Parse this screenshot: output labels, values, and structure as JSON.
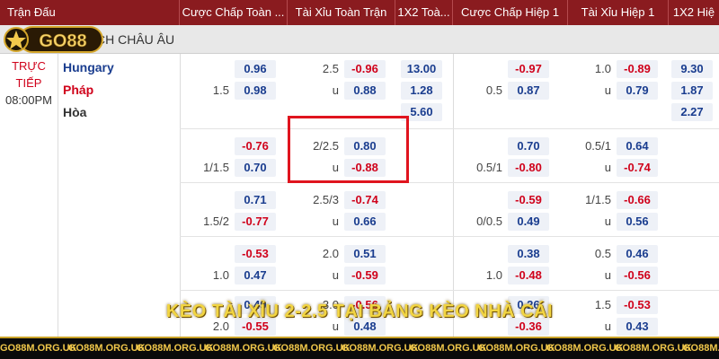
{
  "header": {
    "col_match": "Trận Đấu",
    "col_hcp_ft": "Cược Chấp Toàn ...",
    "col_ou_ft": "Tài Xỉu Toàn Trận",
    "col_1x2_ft": "1X2 Toà...",
    "col_hcp_h1": "Cược Chấp Hiệp 1",
    "col_ou_h1": "Tài Xỉu Hiệp 1",
    "col_1x2_h1": "1X2 Hiệ"
  },
  "league": "CH CHÂU ÂU",
  "logo_text": "GO88",
  "match": {
    "status_line1": "TRỰC",
    "status_line2": "TIẾP",
    "time": "08:00PM",
    "home": "Hungary",
    "away": "Pháp",
    "draw": "Hòa"
  },
  "odds": [
    {
      "hcp_line_a": "",
      "hcp_odd_a": "0.96",
      "hcp_line_b": "1.5",
      "hcp_odd_b": "0.98",
      "ou_line_a": "2.5",
      "ou_odd_a": "-0.96",
      "ou_line_b": "u",
      "ou_odd_b": "0.88",
      "x12_a": "13.00",
      "x12_b": "1.28",
      "x12_c": "5.60",
      "h1_hcp_line_a": "",
      "h1_hcp_odd_a": "-0.97",
      "h1_hcp_line_b": "0.5",
      "h1_hcp_odd_b": "0.87",
      "h1_ou_line_a": "1.0",
      "h1_ou_odd_a": "-0.89",
      "h1_ou_line_b": "u",
      "h1_ou_odd_b": "0.79",
      "h1_x12_a": "9.30",
      "h1_x12_b": "1.87",
      "h1_x12_c": "2.27"
    },
    {
      "hcp_line_a": "",
      "hcp_odd_a": "-0.76",
      "hcp_line_b": "1/1.5",
      "hcp_odd_b": "0.70",
      "ou_line_a": "2/2.5",
      "ou_odd_a": "0.80",
      "ou_line_b": "u",
      "ou_odd_b": "-0.88",
      "h1_hcp_line_a": "",
      "h1_hcp_odd_a": "0.70",
      "h1_hcp_line_b": "0.5/1",
      "h1_hcp_odd_b": "-0.80",
      "h1_ou_line_a": "0.5/1",
      "h1_ou_odd_a": "0.64",
      "h1_ou_line_b": "u",
      "h1_ou_odd_b": "-0.74"
    },
    {
      "hcp_line_a": "",
      "hcp_odd_a": "0.71",
      "hcp_line_b": "1.5/2",
      "hcp_odd_b": "-0.77",
      "ou_line_a": "2.5/3",
      "ou_odd_a": "-0.74",
      "ou_line_b": "u",
      "ou_odd_b": "0.66",
      "h1_hcp_line_a": "",
      "h1_hcp_odd_a": "-0.59",
      "h1_hcp_line_b": "0/0.5",
      "h1_hcp_odd_b": "0.49",
      "h1_ou_line_a": "1/1.5",
      "h1_ou_odd_a": "-0.66",
      "h1_ou_line_b": "u",
      "h1_ou_odd_b": "0.56"
    },
    {
      "hcp_line_a": "",
      "hcp_odd_a": "-0.53",
      "hcp_line_b": "1.0",
      "hcp_odd_b": "0.47",
      "ou_line_a": "2.0",
      "ou_odd_a": "0.51",
      "ou_line_b": "u",
      "ou_odd_b": "-0.59",
      "h1_hcp_line_a": "",
      "h1_hcp_odd_a": "0.38",
      "h1_hcp_line_b": "1.0",
      "h1_hcp_odd_b": "-0.48",
      "h1_ou_line_a": "0.5",
      "h1_ou_odd_a": "0.46",
      "h1_ou_line_b": "u",
      "h1_ou_odd_b": "-0.56"
    },
    {
      "hcp_line_a": "",
      "hcp_odd_a": "0.49",
      "hcp_line_b": "2.0",
      "hcp_odd_b": "-0.55",
      "ou_line_a": "3.0",
      "ou_odd_a": "-0.56",
      "ou_line_b": "u",
      "ou_odd_b": "0.48",
      "h1_hcp_line_a": "",
      "h1_hcp_odd_a": "0.26",
      "h1_hcp_line_b": "",
      "h1_hcp_odd_b": "-0.36",
      "h1_ou_line_a": "1.5",
      "h1_ou_odd_a": "-0.53",
      "h1_ou_line_b": "u",
      "h1_ou_odd_b": "0.43"
    }
  ],
  "caption": "KÈO TÀI XỈU 2-2.5 TẠI BẢNG KÈO NHÀ CÁI",
  "watermark": "GO88M.ORG.UK",
  "colors": {
    "header_bg": "#8a1b1f",
    "positive": "#1a3d8f",
    "negative": "#d0021b",
    "highlight": "#e0141e",
    "caption": "#f2d542"
  }
}
